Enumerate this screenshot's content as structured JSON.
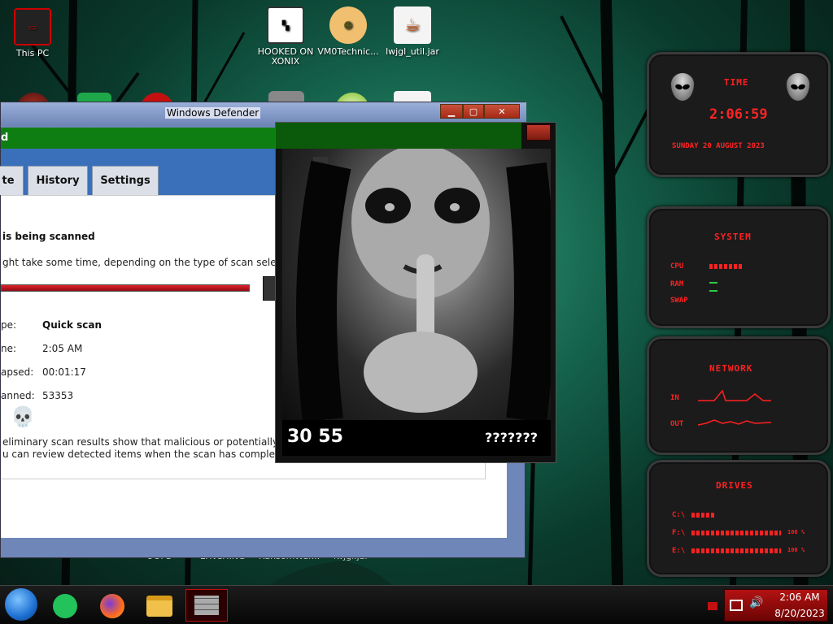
{
  "desktop_icons": [
    {
      "label": "This PC"
    },
    {
      "label": "HOOKED ON XONIX"
    },
    {
      "label": "VM0Technic..."
    },
    {
      "label": "lwjgl_util.jar"
    },
    {
      "label": "OOPS"
    },
    {
      "label": "LYNCHING"
    },
    {
      "label": "RansomWar..."
    },
    {
      "label": "lwjgl.jar"
    }
  ],
  "defender": {
    "window_title": "Windows Defender",
    "header_text": "d",
    "tabs": [
      "te",
      "History",
      "Settings"
    ],
    "scan_heading": "is being scanned",
    "scan_note": "ght take some time, depending on the type of scan selected.",
    "scan_progress_fraction": 0.02,
    "details": [
      {
        "label": "pe:",
        "value": "Quick scan"
      },
      {
        "label": "ne:",
        "value": "2:05 AM"
      },
      {
        "label": "apsed:",
        "value": "00:01:17"
      },
      {
        "label": "anned:",
        "value": "53353"
      }
    ],
    "warning_line1": "eliminary scan results show that malicious or potentially unwanted",
    "warning_line2": "u can review detected items when the scan has completed."
  },
  "image_window": {
    "counter": "30 55",
    "question": "???????"
  },
  "gadgets": {
    "time": {
      "title": "TIME",
      "clock": "2:06:59",
      "date": "SUNDAY 20 AUGUST 2023"
    },
    "system": {
      "title": "SYSTEM",
      "rows": [
        "CPU",
        "RAM",
        "SWAP"
      ]
    },
    "network": {
      "title": "NETWORK",
      "rows": [
        "IN",
        "OUT"
      ]
    },
    "drives": {
      "title": "DRIVES",
      "rows": [
        "C:\\",
        "F:\\",
        "E:\\"
      ],
      "percents": [
        "100 %",
        "100 %"
      ]
    }
  },
  "taskbar": {
    "time": "2:06 AM",
    "date": "8/20/2023"
  },
  "colors": {
    "accent_red": "#ff2020",
    "defender_green": "#0f7e12",
    "defender_blue": "#3a6fba"
  }
}
